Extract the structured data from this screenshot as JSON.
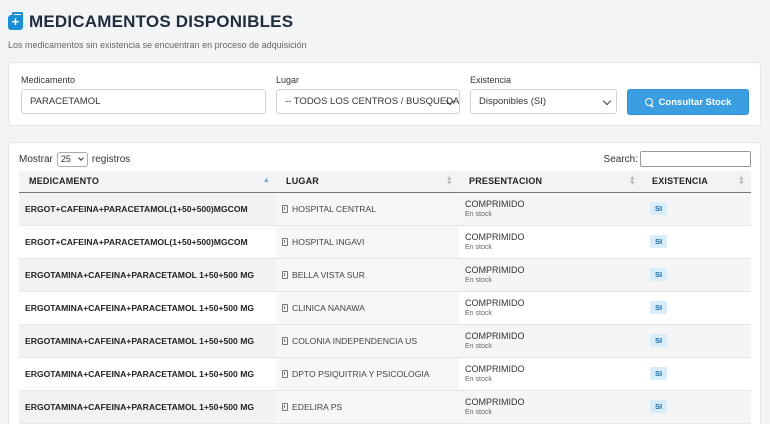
{
  "header": {
    "title": "MEDICAMENTOS DISPONIBLES",
    "subtitle": "Los medicamentos sin existencia se encuentran en proceso de adquisición",
    "icon": "medical-kit-icon"
  },
  "filters": {
    "medicamento_label": "Medicamento",
    "medicamento_value": "PARACETAMOL",
    "lugar_label": "Lugar",
    "lugar_value": "-- TODOS LOS CENTROS / BUSQUEDA GE",
    "existencia_label": "Existencia",
    "existencia_value": "Disponibles (SI)",
    "consultar_label": "Consultar Stock"
  },
  "table": {
    "show_label": "Mostrar",
    "page_length": "25",
    "records_label": "registros",
    "search_label": "Search:",
    "columns": [
      "MEDICAMENTO",
      "LUGAR",
      "PRESENTACION",
      "EXISTENCIA"
    ],
    "rows": [
      {
        "medicamento": "ERGOT+CAFEINA+PARACETAMOL(1+50+500)MGCOM",
        "lugar": "HOSPITAL CENTRAL",
        "presentacion": "COMPRIMIDO",
        "stock": "En stock",
        "existencia": "SI"
      },
      {
        "medicamento": "ERGOT+CAFEINA+PARACETAMOL(1+50+500)MGCOM",
        "lugar": "HOSPITAL INGAVI",
        "presentacion": "COMPRIMIDO",
        "stock": "En stock",
        "existencia": "SI"
      },
      {
        "medicamento": "ERGOTAMINA+CAFEINA+PARACETAMOL 1+50+500 MG",
        "lugar": "BELLA VISTA SUR",
        "presentacion": "COMPRIMIDO",
        "stock": "En stock",
        "existencia": "SI"
      },
      {
        "medicamento": "ERGOTAMINA+CAFEINA+PARACETAMOL 1+50+500 MG",
        "lugar": "CLINICA NANAWA",
        "presentacion": "COMPRIMIDO",
        "stock": "En stock",
        "existencia": "SI"
      },
      {
        "medicamento": "ERGOTAMINA+CAFEINA+PARACETAMOL 1+50+500 MG",
        "lugar": "COLONIA INDEPENDENCIA US",
        "presentacion": "COMPRIMIDO",
        "stock": "En stock",
        "existencia": "SI"
      },
      {
        "medicamento": "ERGOTAMINA+CAFEINA+PARACETAMOL 1+50+500 MG",
        "lugar": "DPTO PSIQUITRIA Y PSICOLOGIA",
        "presentacion": "COMPRIMIDO",
        "stock": "En stock",
        "existencia": "SI"
      },
      {
        "medicamento": "ERGOTAMINA+CAFEINA+PARACETAMOL 1+50+500 MG",
        "lugar": "EDELIRA PS",
        "presentacion": "COMPRIMIDO",
        "stock": "En stock",
        "existencia": "SI"
      }
    ]
  },
  "colors": {
    "accent": "#3a9ee0",
    "badge_bg": "#d8ecfa",
    "badge_text": "#1569a8"
  }
}
